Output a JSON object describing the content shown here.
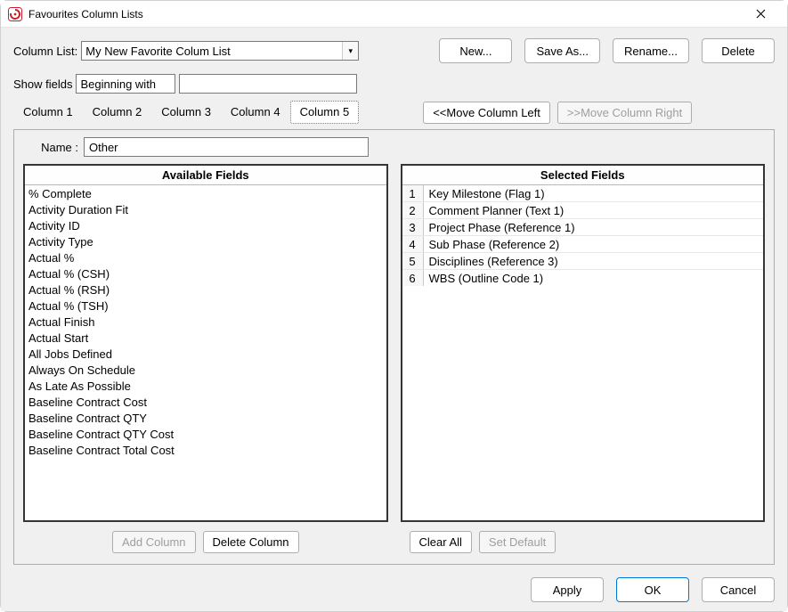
{
  "window": {
    "title": "Favourites Column Lists",
    "icon_name": "app-icon"
  },
  "top": {
    "column_list_label": "Column List:",
    "column_list_value": "My New Favorite Colum List",
    "buttons": {
      "new": "New...",
      "save_as": "Save As...",
      "rename": "Rename...",
      "delete": "Delete"
    }
  },
  "filter": {
    "show_fields_label": "Show fields",
    "mode_value": "Beginning with",
    "search_value": ""
  },
  "tabs": {
    "items": [
      {
        "label": "Column 1"
      },
      {
        "label": "Column 2"
      },
      {
        "label": "Column 3"
      },
      {
        "label": "Column 4"
      },
      {
        "label": "Column 5"
      }
    ],
    "selected_index": 4,
    "move_left": "<<Move Column Left",
    "move_right": ">>Move Column Right"
  },
  "panel": {
    "name_label": "Name :",
    "name_value": "Other",
    "available_header": "Available Fields",
    "selected_header": "Selected Fields",
    "available": [
      "% Complete",
      "Activity Duration Fit",
      "Activity ID",
      "Activity Type",
      "Actual %",
      "Actual % (CSH)",
      "Actual % (RSH)",
      "Actual % (TSH)",
      "Actual Finish",
      "Actual Start",
      "All Jobs Defined",
      "Always On Schedule",
      "As Late As Possible",
      "Baseline Contract Cost",
      "Baseline Contract QTY",
      "Baseline Contract QTY Cost",
      "Baseline Contract Total Cost"
    ],
    "selected": [
      "Key Milestone (Flag 1)",
      "Comment Planner (Text 1)",
      "Project Phase (Reference 1)",
      "Sub Phase (Reference 2)",
      "Disciplines (Reference 3)",
      "WBS (Outline Code 1)"
    ],
    "actions": {
      "add_column": "Add Column",
      "delete_column": "Delete Column",
      "clear_all": "Clear All",
      "set_default": "Set Default"
    }
  },
  "footer": {
    "apply": "Apply",
    "ok": "OK",
    "cancel": "Cancel"
  }
}
